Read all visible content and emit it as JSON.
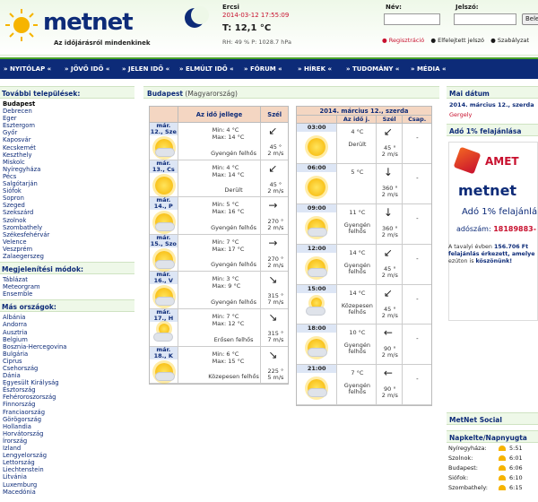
{
  "header": {
    "logo_text": "metnet",
    "tagline": "Az időjárásról mindenkinek",
    "city": "Ercsi",
    "datetime": "2014-03-12 17:55:09",
    "temp": "T: 12,1 °C",
    "rh": "RH: 49 % P: 1028.7 hPa",
    "login_nev": "Név:",
    "login_jelszo": "Jelszó:",
    "login_btn": "Bele",
    "link_reg": "● Regisztráció",
    "link_forgot": "● Elfelejtett jelszó",
    "link_rules": "● Szabályzat"
  },
  "nav": [
    "» NYITÓLAP «",
    "» JÖVŐ IDŐ «",
    "» JELEN IDŐ «",
    "» ELMÚLT IDŐ «",
    "» FÓRUM «",
    "» HÍREK «",
    "» TUDOMÁNY «",
    "» MÉDIA «"
  ],
  "left": {
    "title_towns": "További települések:",
    "towns": [
      "Budapest",
      "Debrecen",
      "Eger",
      "Esztergom",
      "Győr",
      "Kaposvár",
      "Kecskemét",
      "Keszthely",
      "Miskolc",
      "Nyíregyháza",
      "Pécs",
      "Salgótarján",
      "Siófok",
      "Sopron",
      "Szeged",
      "Szekszárd",
      "Szolnok",
      "Szombathely",
      "Székesfehérvár",
      "Velence",
      "Veszprém",
      "Zalaegerszeg"
    ],
    "title_display": "Megjelenítési módok:",
    "display_modes": [
      "Táblázat",
      "Meteorgram",
      "Ensemble"
    ],
    "title_countries": "Más országok:",
    "countries": [
      "Albánia",
      "Andorra",
      "Ausztria",
      "Belgium",
      "Bosznia-Hercegovina",
      "Bulgária",
      "Ciprus",
      "Csehország",
      "Dánia",
      "Egyesült Királyság",
      "Észtország",
      "Fehéroroszország",
      "Finnország",
      "Franciaország",
      "Görögország",
      "Hollandia",
      "Horvátország",
      "Írország",
      "Izland",
      "Lengyelország",
      "Lettország",
      "Liechtenstein",
      "Litvánia",
      "Luxemburg",
      "Macedónia"
    ]
  },
  "mid": {
    "city": "Budapest",
    "country": "(Magyarország)",
    "daily_headers": [
      "",
      "Az idő jellege",
      "Szél"
    ],
    "daily": [
      {
        "date": "már. 12., Sze",
        "min": "Min: 4 °C",
        "max": "Max: 14 °C",
        "desc": "Gyengén felhős",
        "arrow": "↙",
        "wind_dir": "45 °",
        "wind_speed": "2 m/s",
        "icon": "partly-cloudy-icon"
      },
      {
        "date": "már. 13., Cs",
        "min": "Min: 4 °C",
        "max": "Max: 14 °C",
        "desc": "Derült",
        "arrow": "↙",
        "wind_dir": "45 °",
        "wind_speed": "2 m/s",
        "icon": "sun-icon"
      },
      {
        "date": "már. 14., P",
        "min": "Min: 5 °C",
        "max": "Max: 16 °C",
        "desc": "Gyengén felhős",
        "arrow": "→",
        "wind_dir": "270 °",
        "wind_speed": "2 m/s",
        "icon": "partly-cloudy-icon"
      },
      {
        "date": "már. 15., Szo",
        "min": "Min: 7 °C",
        "max": "Max: 17 °C",
        "desc": "Gyengén felhős",
        "arrow": "→",
        "wind_dir": "270 °",
        "wind_speed": "2 m/s",
        "icon": "partly-cloudy-icon"
      },
      {
        "date": "már. 16., V",
        "min": "Min: 3 °C",
        "max": "Max: 9 °C",
        "desc": "Gyengén felhős",
        "arrow": "↘",
        "wind_dir": "315 °",
        "wind_speed": "7 m/s",
        "icon": "partly-cloudy-icon"
      },
      {
        "date": "már. 17., H",
        "min": "Min: 7 °C",
        "max": "Max: 12 °C",
        "desc": "Erősen felhős",
        "arrow": "↘",
        "wind_dir": "315 °",
        "wind_speed": "7 m/s",
        "icon": "cloudy-icon"
      },
      {
        "date": "már. 18., K",
        "min": "Min: 6 °C",
        "max": "Max: 15 °C",
        "desc": "Közepesen felhős",
        "arrow": "↘",
        "wind_dir": "225 °",
        "wind_speed": "5 m/s",
        "icon": "partly-cloudy-icon"
      }
    ],
    "hourly_date": "2014. március 12., szerda",
    "hourly_headers": [
      "",
      "Az idő j.",
      "Szél",
      "Csap."
    ],
    "hourly": [
      {
        "time": "03:00",
        "temp": "4 °C",
        "desc": "Derült",
        "arrow": "↙",
        "wind_dir": "45 °",
        "wind_speed": "2 m/s",
        "precip": "-",
        "icon": "sun-icon"
      },
      {
        "time": "06:00",
        "temp": "5 °C",
        "desc": "",
        "arrow": "↓",
        "wind_dir": "360 °",
        "wind_speed": "2 m/s",
        "precip": "-",
        "icon": "sun-icon"
      },
      {
        "time": "09:00",
        "temp": "11 °C",
        "desc": "Gyengén felhős",
        "arrow": "↓",
        "wind_dir": "360 °",
        "wind_speed": "2 m/s",
        "precip": "-",
        "icon": "partly-cloudy-icon"
      },
      {
        "time": "12:00",
        "temp": "14 °C",
        "desc": "Gyengén felhős",
        "arrow": "↙",
        "wind_dir": "45 °",
        "wind_speed": "2 m/s",
        "precip": "-",
        "icon": "partly-cloudy-icon"
      },
      {
        "time": "15:00",
        "temp": "14 °C",
        "desc": "Közepesen felhős",
        "arrow": "↙",
        "wind_dir": "45 °",
        "wind_speed": "2 m/s",
        "precip": "-",
        "icon": "cloudy-icon"
      },
      {
        "time": "18:00",
        "temp": "10 °C",
        "desc": "Gyengén felhős",
        "arrow": "←",
        "wind_dir": "90 °",
        "wind_speed": "2 m/s",
        "precip": "-",
        "icon": "partly-cloudy-icon"
      },
      {
        "time": "21:00",
        "temp": "7 °C",
        "desc": "Gyengén felhős",
        "arrow": "←",
        "wind_dir": "90 °",
        "wind_speed": "2 m/s",
        "precip": "-",
        "icon": "partly-cloudy-icon"
      }
    ]
  },
  "right": {
    "title_date": "Mai dátum",
    "date": "2014. március 12., szerda",
    "nameday": "Gergely",
    "title_ado": "Adó 1% felajánlása",
    "ad_amet": "AMET",
    "ad_metnet": "metnet",
    "ad_ado1": "Adó 1% felajánlá",
    "ad_adoszam_label": "adószám:",
    "ad_adoszam": "18189883-",
    "note_pre": "A tavalyi évben",
    "note_amount": "156.706 Ft",
    "note_mid": "felajánlás érkezett, amelye",
    "note_end_pre": "ezúton is",
    "note_thanks": "köszönünk!",
    "title_social": "MetNet Social",
    "title_sun": "Napkelte/Napnyugta",
    "sun_rows": [
      {
        "city": "Nyíregyháza:",
        "time": "5:51"
      },
      {
        "city": "Szolnok:",
        "time": "6:01"
      },
      {
        "city": "Budapest:",
        "time": "6:06"
      },
      {
        "city": "Siófok:",
        "time": "6:10"
      },
      {
        "city": "Szombathely:",
        "time": "6:15"
      }
    ]
  },
  "colors": {
    "brand_navy": "#0d2b78",
    "accent_red": "#c8102e",
    "header_green": "#4aa32a",
    "table_head": "#f4d6c2",
    "date_cell": "#dde6f5"
  }
}
